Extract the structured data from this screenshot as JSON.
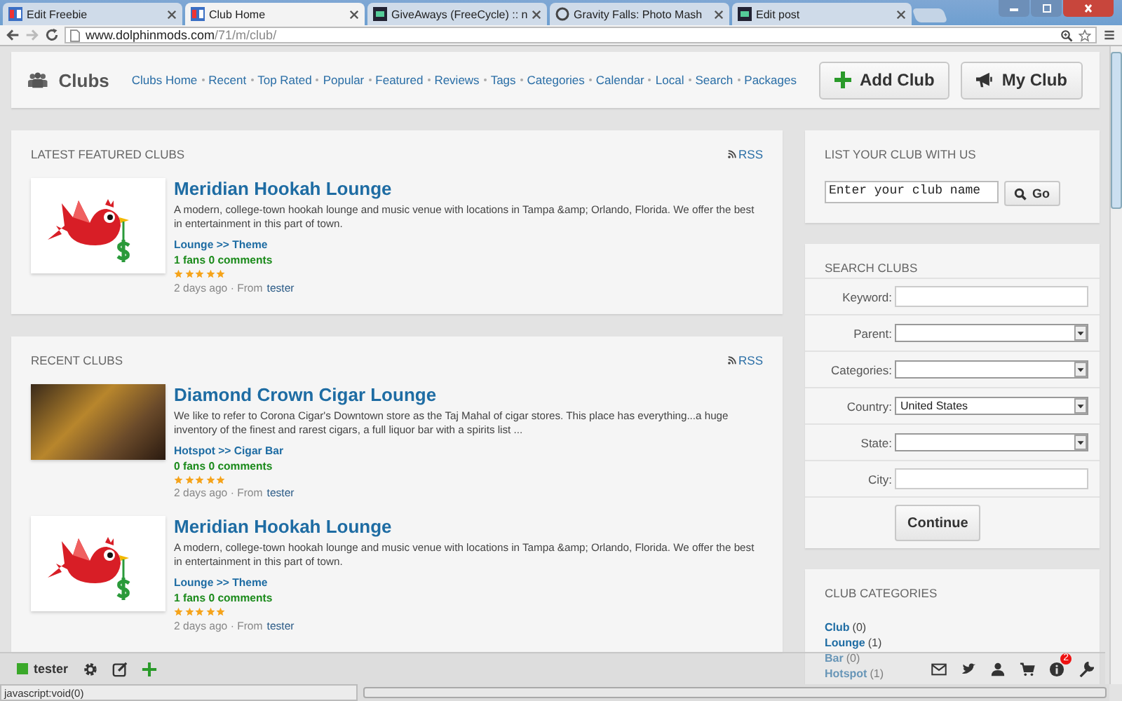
{
  "browser": {
    "tabs": [
      {
        "title": "Edit Freebie",
        "selected": false,
        "kind": "grid"
      },
      {
        "title": "Club Home",
        "selected": true,
        "kind": "grid"
      },
      {
        "title": "GiveAways (FreeCycle) :: n",
        "selected": false,
        "kind": "dark"
      },
      {
        "title": "Gravity Falls: Photo Mash",
        "selected": false,
        "kind": "circle"
      },
      {
        "title": "Edit post",
        "selected": false,
        "kind": "dark"
      }
    ],
    "url": {
      "domain": "www.dolphinmods.com",
      "path": "/71/m/club/"
    }
  },
  "nav": {
    "title": "Clubs",
    "links": [
      "Clubs Home",
      "Recent",
      "Top Rated",
      "Popular",
      "Featured",
      "Reviews",
      "Tags",
      "Categories",
      "Calendar",
      "Local",
      "Search",
      "Packages"
    ],
    "buttons": [
      {
        "label": "Add Club",
        "kind": "add"
      },
      {
        "label": "My Club",
        "kind": "announce"
      }
    ]
  },
  "sections": [
    {
      "heading": "LATEST FEATURED CLUBS",
      "rss": "RSS",
      "clubs": [
        {
          "name": "Meridian Hookah Lounge",
          "kind": "bird",
          "description": "A modern, college-town hookah lounge and music venue with locations in Tampa &amp; Orlando, Florida. We offer the best in entertainment in this part of town.",
          "category": "Lounge >> Theme",
          "stats": "1 fans 0 comments",
          "stars": 5,
          "posted": "2 days ago · From",
          "author": "tester"
        }
      ]
    },
    {
      "heading": "RECENT CLUBS",
      "rss": "RSS",
      "clubs": [
        {
          "name": "Diamond Crown Cigar Lounge",
          "kind": "photo",
          "description": "We like to refer to Corona Cigar's Downtown store as the Taj Mahal of cigar stores. This place has everything...a huge inventory of the finest and rarest cigars, a full liquor bar with a spirits list ...",
          "category": "Hotspot >> Cigar Bar",
          "stats": "0 fans 0 comments",
          "stars": 5,
          "posted": "2 days ago · From",
          "author": "tester"
        },
        {
          "name": "Meridian Hookah Lounge",
          "kind": "bird",
          "description": "A modern, college-town hookah lounge and music venue with locations in Tampa &amp; Orlando, Florida. We offer the best in entertainment in this part of town.",
          "category": "Lounge >> Theme",
          "stats": "1 fans 0 comments",
          "stars": 5,
          "posted": "2 days ago · From",
          "author": "tester"
        }
      ]
    }
  ],
  "list_club": {
    "heading": "LIST YOUR CLUB WITH US",
    "placeholder": "Enter your club name",
    "button": "Go"
  },
  "search": {
    "heading": "SEARCH CLUBS",
    "fields": [
      {
        "label": "Keyword:",
        "kind": "text"
      },
      {
        "label": "Parent:",
        "kind": "select"
      },
      {
        "label": "Categories:",
        "kind": "select"
      },
      {
        "label": "Country:",
        "kind": "select",
        "value": "United States"
      },
      {
        "label": "State:",
        "kind": "select"
      },
      {
        "label": "City:",
        "kind": "text"
      }
    ],
    "button": "Continue"
  },
  "categories": {
    "heading": "CLUB CATEGORIES",
    "items": [
      {
        "name": "Club",
        "count": "(0)"
      },
      {
        "name": "Lounge",
        "count": "(1)"
      },
      {
        "name": "Bar",
        "count": "(0)"
      },
      {
        "name": "Hotspot",
        "count": "(1)"
      }
    ]
  },
  "toolbar": {
    "user": "tester",
    "notifications": "2"
  },
  "status_bar": "javascript:void(0)"
}
